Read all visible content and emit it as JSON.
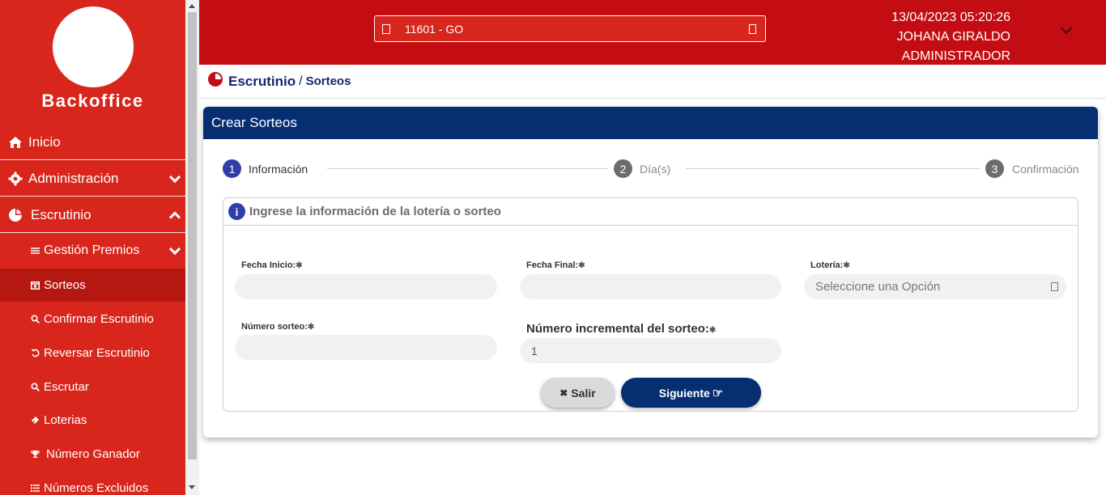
{
  "brand": "Backoffice",
  "sidebar": {
    "items": [
      {
        "label": "Inicio",
        "icon": "home-icon"
      },
      {
        "label": "Administración",
        "icon": "gear-icon"
      },
      {
        "label": "Escrutinio",
        "icon": "pie-chart-icon"
      },
      {
        "label": "Gestión Premios",
        "icon": "sliders-icon"
      },
      {
        "label": "Sorteos",
        "icon": "calendar-icon"
      },
      {
        "label": "Confirmar Escrutinio",
        "icon": "search-icon"
      },
      {
        "label": "Reversar Escrutinio",
        "icon": "undo-icon"
      },
      {
        "label": "Escrutar",
        "icon": "search-icon"
      },
      {
        "label": "Loterias",
        "icon": "ticket-icon"
      },
      {
        "label": "Número Ganador",
        "icon": "trophy-icon"
      },
      {
        "label": "Números Excluidos",
        "icon": "list-icon"
      }
    ]
  },
  "header": {
    "store": "11601 - GO",
    "datetime": "13/04/2023 05:20:26",
    "user": "JOHANA GIRALDO",
    "role": "ADMINISTRADOR"
  },
  "breadcrumb": {
    "section": "Escrutinio",
    "separator": "/",
    "page": "Sorteos"
  },
  "card": {
    "title": "Crear Sorteos"
  },
  "stepper": [
    {
      "num": "1",
      "label": "Información"
    },
    {
      "num": "2",
      "label": "Día(s)"
    },
    {
      "num": "3",
      "label": "Confirmación"
    }
  ],
  "panel": {
    "title": "Ingrese la información de la lotería o sorteo"
  },
  "form": {
    "fecha_inicio_label": "Fecha Inicio:",
    "fecha_final_label": "Fecha Final:",
    "loteria_label": "Lotería:",
    "loteria_placeholder": "Seleccione una Opción",
    "numero_sorteo_label": "Número sorteo:",
    "incremental_label": "Número incremental del sorteo:",
    "incremental_value": "1",
    "required_mark": "✱"
  },
  "buttons": {
    "exit": "Salir",
    "exit_icon": "✖",
    "next": "Siguiente",
    "next_icon": "☞"
  },
  "colors": {
    "sidebar": "#d9261c",
    "header": "#c30d12",
    "primary": "#062f72",
    "step_active": "#2f3ea8"
  }
}
